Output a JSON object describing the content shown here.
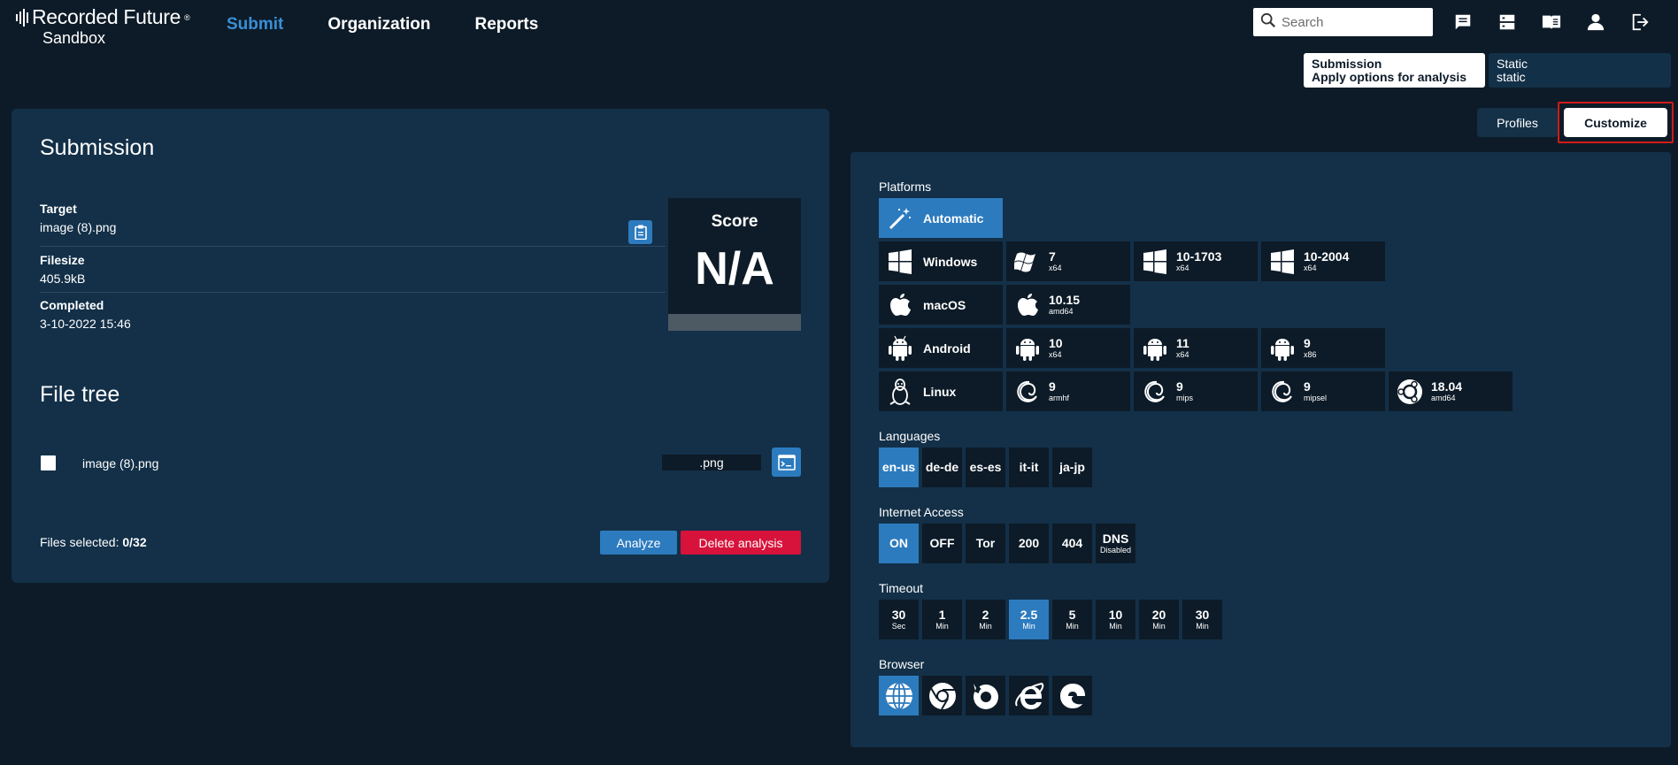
{
  "header": {
    "brand": "Recorded Future",
    "brand_mark": "®",
    "product": "Sandbox",
    "nav": [
      {
        "label": "Submit",
        "active": true
      },
      {
        "label": "Organization",
        "active": false
      },
      {
        "label": "Reports",
        "active": false
      }
    ],
    "search_placeholder": "Search",
    "icons": [
      "message-icon",
      "server-icon",
      "book-icon",
      "user-icon",
      "logout-icon"
    ]
  },
  "mode_tabs": {
    "submission_title": "Submission",
    "submission_sub": "Apply options for analysis",
    "static_title": "Static",
    "static_sub": "static"
  },
  "option_tabs": {
    "profiles": "Profiles",
    "customize": "Customize"
  },
  "submission": {
    "title": "Submission",
    "target_label": "Target",
    "target_value": "image (8).png",
    "filesize_label": "Filesize",
    "filesize_value": "405.9kB",
    "completed_label": "Completed",
    "completed_value": "3-10-2022 15:46",
    "score_label": "Score",
    "score_value": "N/A"
  },
  "file_tree": {
    "title": "File tree",
    "file_name": "image (8).png",
    "file_ext": ".png",
    "files_selected_label": "Files selected:",
    "files_selected_value": "0/32",
    "analyze_label": "Analyze",
    "delete_label": "Delete analysis"
  },
  "platforms": {
    "label": "Platforms",
    "automatic": "Automatic",
    "windows": "Windows",
    "win7_v": "7",
    "win7_a": "x64",
    "win1703_v": "10-1703",
    "win1703_a": "x64",
    "win2004_v": "10-2004",
    "win2004_a": "x64",
    "macos": "macOS",
    "mac_v": "10.15",
    "mac_a": "amd64",
    "android": "Android",
    "and10_v": "10",
    "and10_a": "x64",
    "and11_v": "11",
    "and11_a": "x64",
    "and9_v": "9",
    "and9_a": "x86",
    "linux": "Linux",
    "deb_armhf_v": "9",
    "deb_armhf_a": "armhf",
    "deb_mips_v": "9",
    "deb_mips_a": "mips",
    "deb_mipsel_v": "9",
    "deb_mipsel_a": "mipsel",
    "ubuntu_v": "18.04",
    "ubuntu_a": "amd64"
  },
  "languages": {
    "label": "Languages",
    "items": [
      "en-us",
      "de-de",
      "es-es",
      "it-it",
      "ja-jp"
    ],
    "selected": "en-us"
  },
  "internet": {
    "label": "Internet Access",
    "items": [
      "ON",
      "OFF",
      "Tor",
      "200",
      "404"
    ],
    "dns_top": "DNS",
    "dns_bottom": "Disabled",
    "selected": "ON"
  },
  "timeout": {
    "label": "Timeout",
    "items": [
      {
        "v": "30",
        "u": "Sec"
      },
      {
        "v": "1",
        "u": "Min"
      },
      {
        "v": "2",
        "u": "Min"
      },
      {
        "v": "2.5",
        "u": "Min"
      },
      {
        "v": "5",
        "u": "Min"
      },
      {
        "v": "10",
        "u": "Min"
      },
      {
        "v": "20",
        "u": "Min"
      },
      {
        "v": "30",
        "u": "Min"
      }
    ],
    "selected": "2.5"
  },
  "browser": {
    "label": "Browser",
    "items": [
      "globe-icon",
      "chrome-icon",
      "firefox-icon",
      "internet-explorer-icon",
      "edge-icon"
    ],
    "selected": "globe-icon"
  },
  "colors": {
    "background": "#0d1b28",
    "panel": "#133048",
    "accent": "#2d7bbf",
    "danger": "#d7133b",
    "highlight_box": "#d31a1a"
  }
}
